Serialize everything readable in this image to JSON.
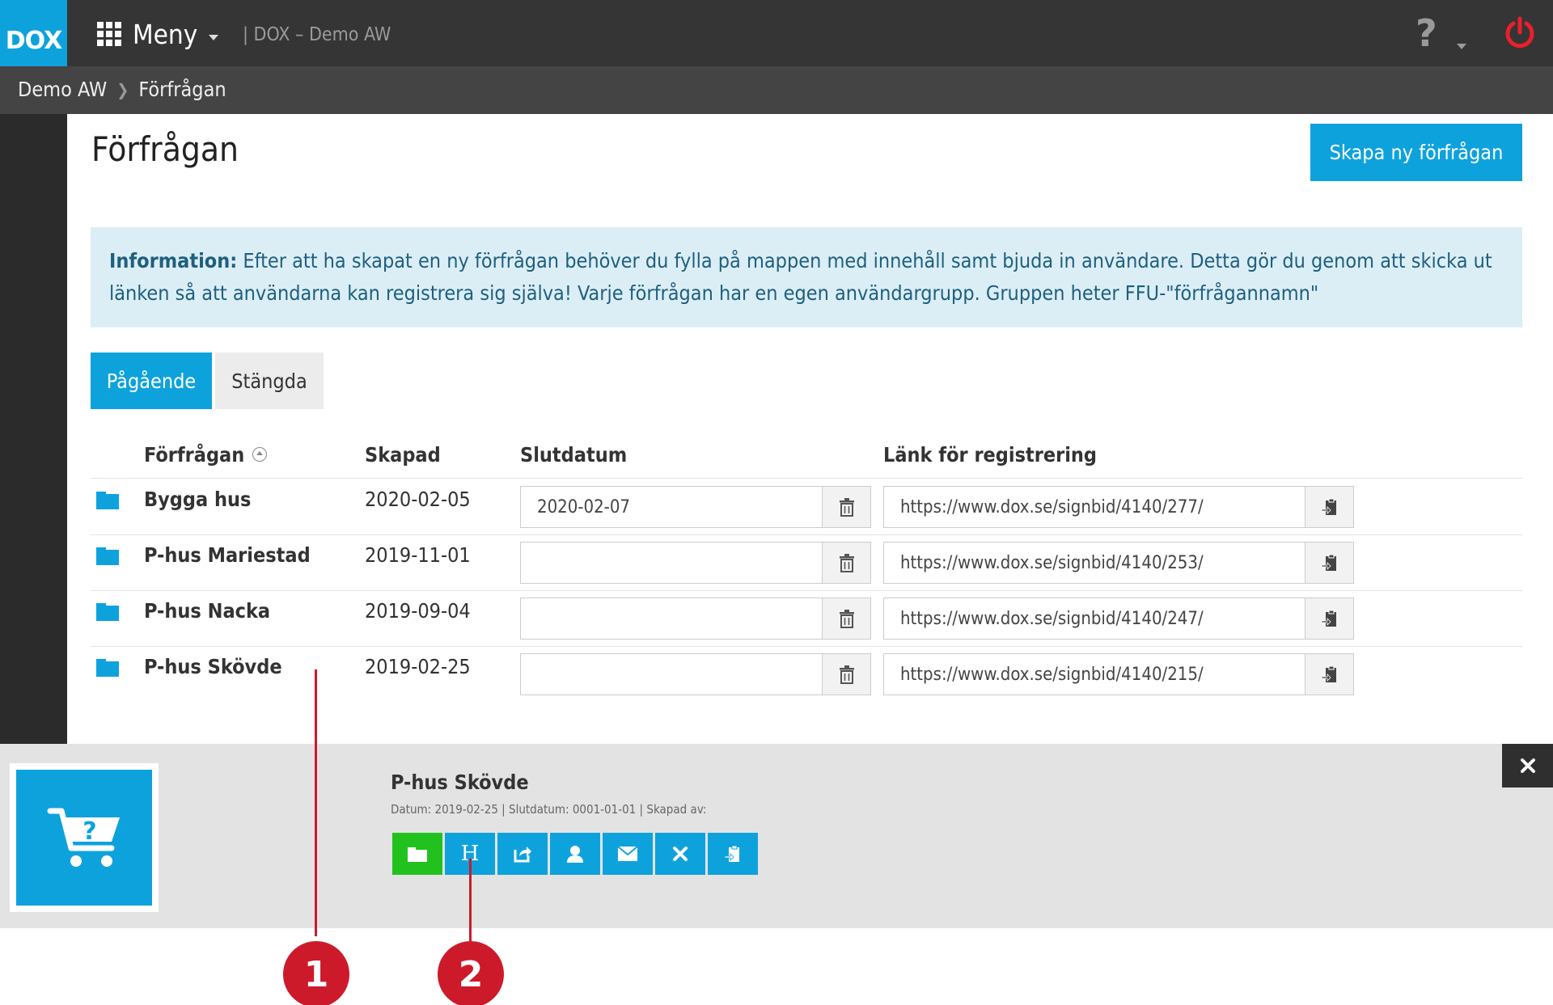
{
  "header": {
    "logo": "DOX",
    "menu_label": "Meny",
    "app_title": "| DOX – Demo AW",
    "help_label": "?"
  },
  "breadcrumb": [
    "Demo AW",
    "Förfrågan"
  ],
  "page": {
    "title": "Förfrågan",
    "create_button": "Skapa ny förfrågan"
  },
  "info": {
    "label": "Information:",
    "text": "Efter att ha skapat en ny förfrågan behöver du fylla på mappen med innehåll samt bjuda in användare. Detta gör du genom att skicka ut länken så att användarna kan registrera sig själva! Varje förfrågan har en egen användargrupp. Gruppen heter FFU-\"förfrågannamn\""
  },
  "tabs": [
    "Pågående",
    "Stängda"
  ],
  "table": {
    "columns": [
      "Förfrågan",
      "Skapad",
      "Slutdatum",
      "Länk för registrering"
    ],
    "rows": [
      {
        "name": "Bygga hus",
        "created": "2020-02-05",
        "end_date": "2020-02-07",
        "link": "https://www.dox.se/signbid/4140/277/"
      },
      {
        "name": "P-hus Mariestad",
        "created": "2019-11-01",
        "end_date": "",
        "link": "https://www.dox.se/signbid/4140/253/"
      },
      {
        "name": "P-hus Nacka",
        "created": "2019-09-04",
        "end_date": "",
        "link": "https://www.dox.se/signbid/4140/247/"
      },
      {
        "name": "P-hus Skövde",
        "created": "2019-02-25",
        "end_date": "",
        "link": "https://www.dox.se/signbid/4140/215/"
      }
    ]
  },
  "panel": {
    "title": "P-hus Skövde",
    "meta": "Datum: 2019-02-25 | Slutdatum: 0001-01-01 | Skapad av:",
    "actions": [
      "folder-icon",
      "h-icon",
      "share-icon",
      "user-icon",
      "envelope-icon",
      "close-icon",
      "clipboard-icon"
    ],
    "action_h_label": "H"
  },
  "callouts": [
    "1",
    "2"
  ],
  "colors": {
    "accent": "#0ea2dd",
    "topbar": "#353535",
    "crumbbar": "#444444",
    "green": "#22c21e",
    "callout": "#cc1a2a",
    "power": "#e8202a"
  }
}
